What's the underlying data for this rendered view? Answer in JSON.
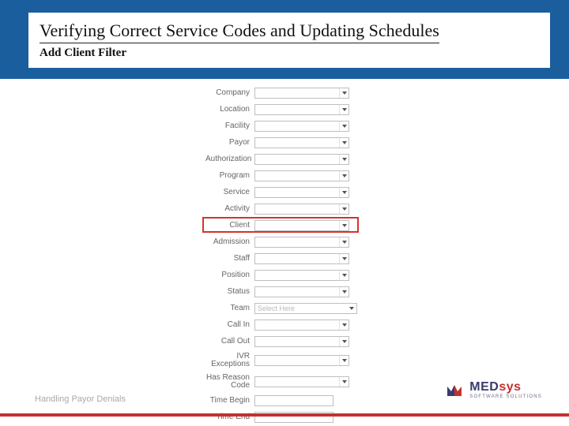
{
  "header": {
    "title": "Verifying Correct Service Codes and Updating Schedules",
    "subtitle": "Add Client Filter"
  },
  "form": {
    "placeholder_select_here": "Select Here",
    "rows": [
      {
        "label": "Company",
        "type": "select"
      },
      {
        "label": "Location",
        "type": "select"
      },
      {
        "label": "Facility",
        "type": "select"
      },
      {
        "label": "Payor",
        "type": "select"
      },
      {
        "label": "Authorization",
        "type": "select"
      },
      {
        "label": "Program",
        "type": "select"
      },
      {
        "label": "Service",
        "type": "select"
      },
      {
        "label": "Activity",
        "type": "select"
      },
      {
        "label": "Client",
        "type": "select",
        "highlighted": true
      },
      {
        "label": "Admission",
        "type": "select"
      },
      {
        "label": "Staff",
        "type": "select"
      },
      {
        "label": "Position",
        "type": "select"
      },
      {
        "label": "Status",
        "type": "select"
      },
      {
        "label": "Team",
        "type": "select_placeholder"
      },
      {
        "label": "Call In",
        "type": "select"
      },
      {
        "label": "Call Out",
        "type": "select"
      },
      {
        "label": "IVR Exceptions",
        "type": "select"
      },
      {
        "label": "Has Reason Code",
        "type": "select"
      },
      {
        "label": "Time Begin",
        "type": "text"
      },
      {
        "label": "Time End",
        "type": "text"
      }
    ]
  },
  "footer": {
    "label": "Handling Payor Denials",
    "brand_med": "MED",
    "brand_sys": "sys",
    "tagline": "SOFTWARE SOLUTIONS"
  }
}
